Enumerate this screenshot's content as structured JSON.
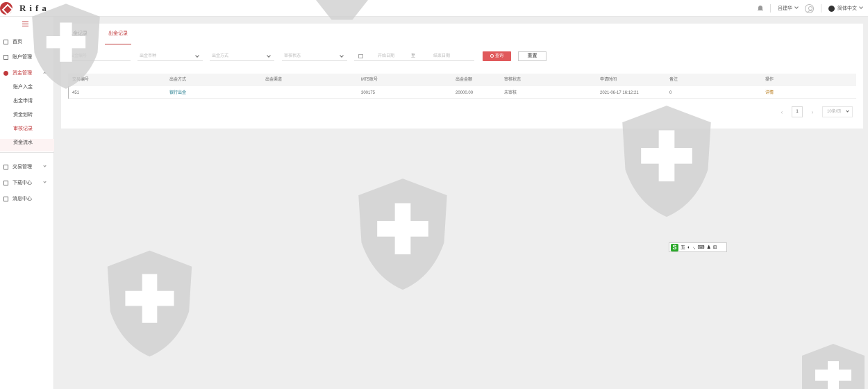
{
  "app": {
    "logo_text": "Rifa"
  },
  "header": {
    "user_name": "吕建华",
    "language": "简体中文"
  },
  "sidebar": {
    "items": [
      {
        "label": "首页"
      },
      {
        "label": "账户管理"
      },
      {
        "label": "资金管理"
      },
      {
        "label": "交易管理"
      },
      {
        "label": "下载中心"
      },
      {
        "label": "消息中心"
      }
    ],
    "sub_items": [
      {
        "label": "账户入金"
      },
      {
        "label": "出金申请"
      },
      {
        "label": "资金划转"
      },
      {
        "label": "审核记录"
      },
      {
        "label": "资金流水"
      }
    ]
  },
  "tabs": [
    {
      "label": "入金记录"
    },
    {
      "label": "出金记录"
    }
  ],
  "filters": {
    "order_no_placeholder": "出金编号",
    "currency_placeholder": "出金币种",
    "method_placeholder": "出金方式",
    "status_placeholder": "审核状态",
    "date_start_placeholder": "开始日期",
    "date_separator": "至",
    "date_end_placeholder": "结束日期",
    "search_label": "查询",
    "reset_label": "重置"
  },
  "table": {
    "columns": [
      "交易编号",
      "出金方式",
      "出金渠道",
      "MT5账号",
      "出金金额",
      "审核状态",
      "申请时间",
      "备注",
      "操作"
    ],
    "rows": [
      {
        "id": "451",
        "method": "银行出金",
        "channel": "",
        "mt5": "300175",
        "amount": "20000.00",
        "status": "未审核",
        "time": "2021-06-17 16:12:21",
        "note": "0",
        "op": "详情"
      }
    ]
  },
  "pagination": {
    "current_page": "1",
    "page_size": "10条/页"
  },
  "ime": {
    "logo": "S",
    "buttons": [
      "五",
      "◐",
      "·,",
      "⌨",
      "♟",
      "⊞"
    ]
  },
  "colors": {
    "accent": "#c0393b",
    "link": "#1f7a8c",
    "op": "#b87b1a"
  }
}
